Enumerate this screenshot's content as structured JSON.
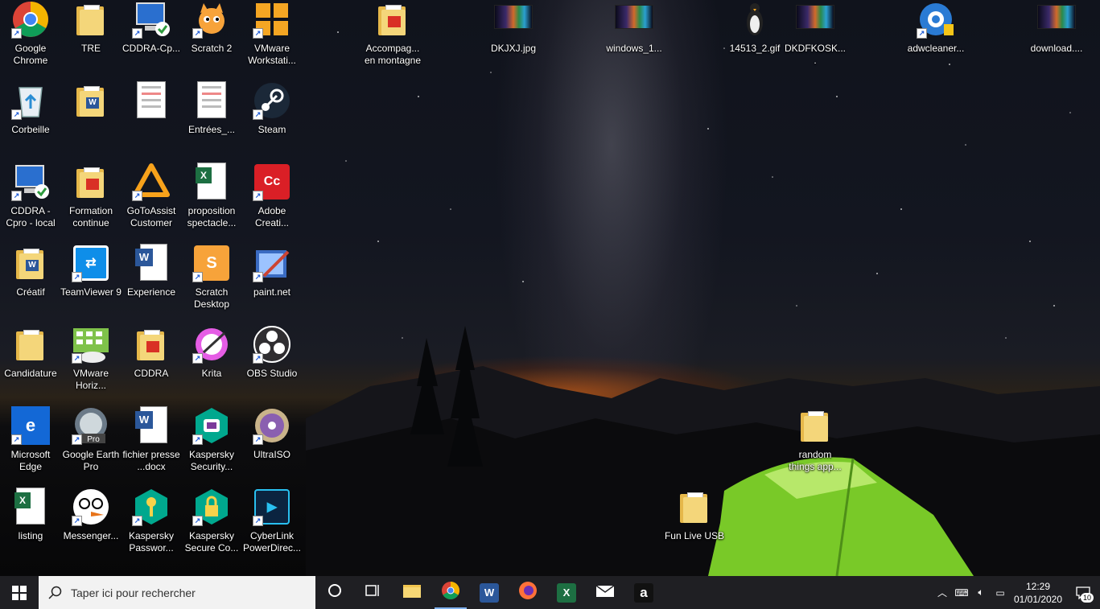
{
  "desktop": {
    "icons": [
      {
        "label": "Google Chrome",
        "icon": "chrome-icon"
      },
      {
        "label": "TRE",
        "icon": "folder-icon"
      },
      {
        "label": "CDDRA-Cp...",
        "icon": "remote-desktop-icon"
      },
      {
        "label": "Scratch 2",
        "icon": "scratch-cat-icon"
      },
      {
        "label": "VMware Workstati...",
        "icon": "vmware-icon"
      },
      {
        "label": "Corbeille",
        "icon": "recycle-bin-icon"
      },
      {
        "label": "",
        "icon": "word-folder-icon"
      },
      {
        "label": "",
        "icon": "document-thumbnail-icon"
      },
      {
        "label": "Entrées_...",
        "icon": "document-thumbnail-icon"
      },
      {
        "label": "Steam",
        "icon": "steam-icon"
      },
      {
        "label": "CDDRA - Cpro - local",
        "icon": "remote-desktop-icon"
      },
      {
        "label": "Formation continue",
        "icon": "pdf-folder-icon"
      },
      {
        "label": "GoToAssist Customer",
        "icon": "gotoassist-icon"
      },
      {
        "label": "proposition spectacle...",
        "icon": "excel-file-icon"
      },
      {
        "label": "Adobe Creati...",
        "icon": "adobe-cc-icon"
      },
      {
        "label": "Créatif",
        "icon": "word-folder-icon"
      },
      {
        "label": "TeamViewer 9",
        "icon": "teamviewer-icon"
      },
      {
        "label": "Experience",
        "icon": "word-file-icon"
      },
      {
        "label": "Scratch Desktop",
        "icon": "scratch-desktop-icon"
      },
      {
        "label": "paint.net",
        "icon": "paintnet-icon"
      },
      {
        "label": "Candidature",
        "icon": "folder-icon"
      },
      {
        "label": "VMware Horiz...",
        "icon": "vmware-horizon-icon"
      },
      {
        "label": "CDDRA",
        "icon": "pdf-folder-icon"
      },
      {
        "label": "Krita",
        "icon": "krita-icon"
      },
      {
        "label": "OBS Studio",
        "icon": "obs-icon"
      },
      {
        "label": "Microsoft Edge",
        "icon": "edge-icon"
      },
      {
        "label": "Google Earth Pro",
        "icon": "google-earth-icon"
      },
      {
        "label": "fichier presse",
        "label2": "...docx",
        "icon": "word-file-icon"
      },
      {
        "label": "Kaspersky Security...",
        "icon": "kaspersky-icon"
      },
      {
        "label": "UltraISO",
        "icon": "ultraiso-icon"
      },
      {
        "label": "listing",
        "icon": "excel-file-icon"
      },
      {
        "label": "Messenger...",
        "icon": "messenger-icon"
      },
      {
        "label": "Kaspersky Passwor...",
        "icon": "kaspersky-password-icon"
      },
      {
        "label": "Kaspersky Secure Co...",
        "icon": "kaspersky-vpn-icon"
      },
      {
        "label": "CyberLink PowerDirec...",
        "icon": "powerdirector-icon"
      },
      {
        "label": "Accompag... en montagne",
        "icon": "pdf-folder-icon"
      },
      {
        "label": "DKJXJ.jpg",
        "icon": "image-thumbnail-icon"
      },
      {
        "label": "windows_1...",
        "icon": "image-thumbnail-icon"
      },
      {
        "label": "14513_2.gif",
        "icon": "penguin-gif-icon"
      },
      {
        "label": "DKDFKOSK....",
        "icon": "image-thumbnail-icon"
      },
      {
        "label": "adwcleaner...",
        "icon": "adwcleaner-icon"
      },
      {
        "label": "download....",
        "icon": "image-thumbnail-icon"
      },
      {
        "label": "random things app...",
        "icon": "folder-icon"
      },
      {
        "label": "Fun Live USB",
        "icon": "folder-icon"
      }
    ]
  },
  "taskbar": {
    "search_placeholder": "Taper ici pour rechercher",
    "pinned": [
      {
        "name": "cortana-button",
        "icon": "circle-icon"
      },
      {
        "name": "task-view-button",
        "icon": "task-view-icon"
      },
      {
        "name": "file-explorer-button",
        "icon": "folder-icon"
      },
      {
        "name": "chrome-button",
        "icon": "chrome-icon",
        "active": true
      },
      {
        "name": "word-button",
        "icon": "word-icon",
        "letter": "W"
      },
      {
        "name": "firefox-button",
        "icon": "firefox-icon"
      },
      {
        "name": "excel-button",
        "icon": "excel-icon",
        "letter": "X"
      },
      {
        "name": "mail-button",
        "icon": "mail-icon"
      },
      {
        "name": "amazon-button",
        "icon": "amazon-icon",
        "letter": "a"
      }
    ],
    "clock_time": "12:29",
    "clock_date": "01/01/2020",
    "notification_count": "10"
  },
  "colors": {
    "taskbar_bg": "#1f1f23",
    "search_bg": "#f2f2f2",
    "accent": "#7fb1ee"
  }
}
